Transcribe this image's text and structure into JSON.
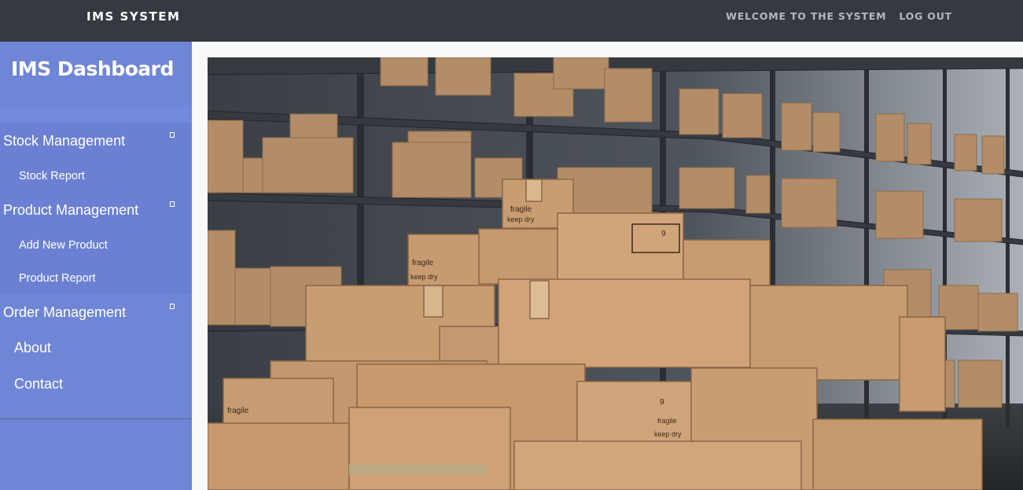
{
  "navbar": {
    "brand": "IMS SYSTEM",
    "links": [
      {
        "label": "WELCOME TO THE SYSTEM"
      },
      {
        "label": "LOG OUT"
      }
    ]
  },
  "sidebar": {
    "title": "IMS Dashboard",
    "stock": {
      "label": "Stock Management",
      "items": [
        "Stock Report"
      ]
    },
    "product": {
      "label": "Product Management",
      "items": [
        "Add New Product",
        "Product Report"
      ]
    },
    "order": {
      "label": "Order Management"
    },
    "about": "About",
    "contact": "Contact"
  },
  "hero": {
    "image": "warehouse-cardboard-boxes-photo",
    "box_labels": {
      "fragile": "fragile",
      "keep_dry": "keep dry",
      "nine": "9"
    }
  },
  "colors": {
    "topbar": "#343a40",
    "sidebar": "#6f85d6",
    "submenu_bg": "#6b80d2",
    "page_bg": "#f8f9fa"
  }
}
